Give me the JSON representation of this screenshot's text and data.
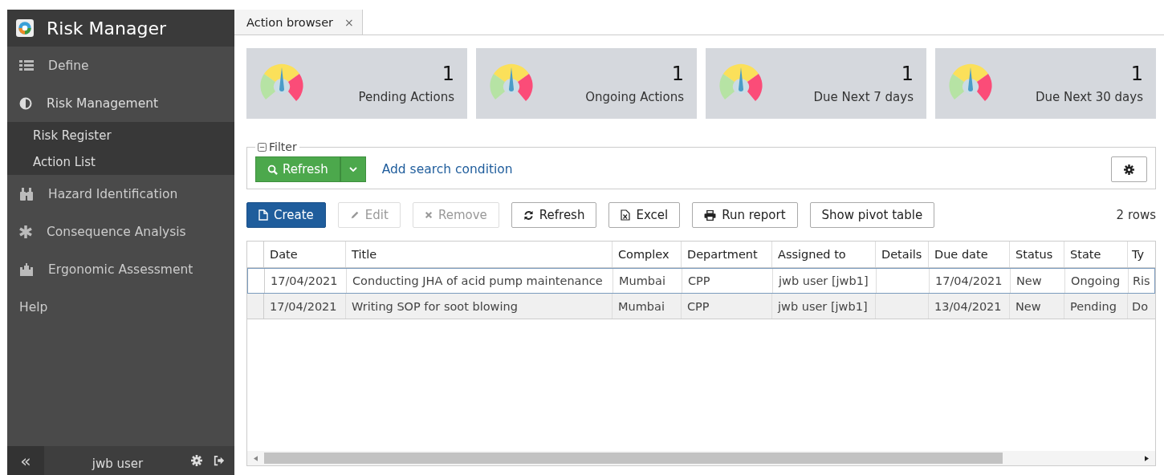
{
  "app": {
    "title": "Risk Manager"
  },
  "sidebar": {
    "items": [
      {
        "label": "Define",
        "expanded": false
      },
      {
        "label": "Risk Management",
        "expanded": true,
        "children": [
          {
            "label": "Risk Register"
          },
          {
            "label": "Action List"
          }
        ]
      },
      {
        "label": "Hazard Identification",
        "expanded": false
      },
      {
        "label": "Consequence Analysis",
        "expanded": false
      },
      {
        "label": "Ergonomic Assessment",
        "expanded": false
      },
      {
        "label": "Help",
        "expanded": false
      }
    ],
    "footer": {
      "collapse": "«",
      "user": "jwb user"
    }
  },
  "tabs": [
    {
      "label": "Action browser",
      "close": "×"
    }
  ],
  "cards": [
    {
      "count": "1",
      "label": "Pending Actions"
    },
    {
      "count": "1",
      "label": "Ongoing Actions"
    },
    {
      "count": "1",
      "label": "Due Next 7 days"
    },
    {
      "count": "1",
      "label": "Due Next 30 days"
    }
  ],
  "filter": {
    "legend": "Filter",
    "refresh": "Refresh",
    "add_condition": "Add search condition"
  },
  "toolbar": {
    "buttons": [
      {
        "label": "Create",
        "kind": "primary",
        "disabled": false
      },
      {
        "label": "Edit",
        "kind": "default",
        "disabled": true
      },
      {
        "label": "Remove",
        "kind": "default",
        "disabled": true
      },
      {
        "label": "Refresh",
        "kind": "default",
        "disabled": false
      },
      {
        "label": "Excel",
        "kind": "default",
        "disabled": false
      },
      {
        "label": "Run report",
        "kind": "default",
        "disabled": false
      },
      {
        "label": "Show pivot table",
        "kind": "default",
        "disabled": false
      }
    ],
    "row_count": "2 rows"
  },
  "table": {
    "columns": [
      "Date",
      "Title",
      "Complex",
      "Department",
      "Assigned to",
      "Details",
      "Due date",
      "Status",
      "State",
      "Ty"
    ],
    "rows": [
      {
        "selected": true,
        "cells": [
          "17/04/2021",
          "Conducting JHA of acid pump maintenance",
          "Mumbai",
          "CPP",
          "jwb user [jwb1]",
          "",
          "17/04/2021",
          "New",
          "Ongoing",
          "Ris"
        ]
      },
      {
        "selected": false,
        "cells": [
          "17/04/2021",
          "Writing SOP for soot blowing",
          "Mumbai",
          "CPP",
          "jwb user [jwb1]",
          "",
          "13/04/2021",
          "New",
          "Pending",
          "Do"
        ]
      }
    ]
  }
}
